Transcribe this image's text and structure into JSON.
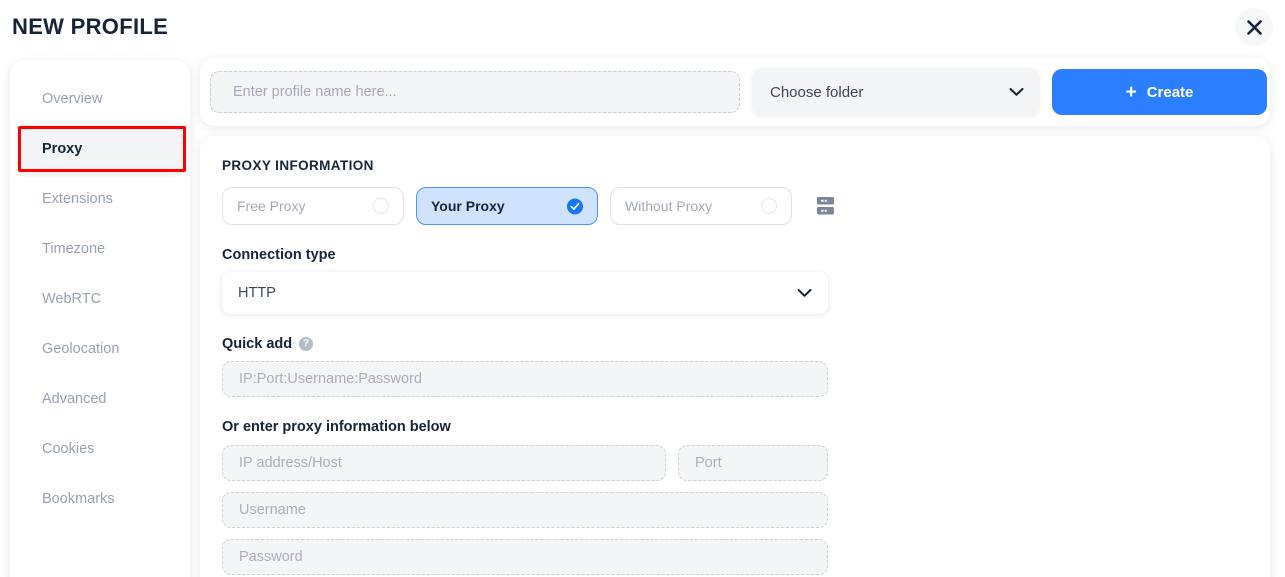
{
  "header": {
    "title": "NEW PROFILE",
    "close_icon": "close-icon"
  },
  "sidebar": {
    "items": [
      {
        "label": "Overview",
        "active": false
      },
      {
        "label": "Proxy",
        "active": true
      },
      {
        "label": "Extensions",
        "active": false
      },
      {
        "label": "Timezone",
        "active": false
      },
      {
        "label": "WebRTC",
        "active": false
      },
      {
        "label": "Geolocation",
        "active": false
      },
      {
        "label": "Advanced",
        "active": false
      },
      {
        "label": "Cookies",
        "active": false
      },
      {
        "label": "Bookmarks",
        "active": false
      }
    ]
  },
  "toolbar": {
    "profile_name_value": "",
    "profile_name_placeholder": "Enter profile name here...",
    "folder_label": "Choose folder",
    "folder_chevron_icon": "chevron-down-icon",
    "create_label": "Create",
    "create_plus_icon": "plus-icon"
  },
  "proxy": {
    "section_title": "PROXY INFORMATION",
    "modes": [
      {
        "label": "Free Proxy",
        "selected": false
      },
      {
        "label": "Your Proxy",
        "selected": true
      },
      {
        "label": "Without Proxy",
        "selected": false
      }
    ],
    "server_icon": "server-icon",
    "connection_type_label": "Connection type",
    "connection_type_value": "HTTP",
    "connection_chevron_icon": "chevron-down-icon",
    "quick_add_label": "Quick add",
    "quick_add_help_icon": "help-icon",
    "quick_add_help_glyph": "?",
    "quick_add_value": "",
    "quick_add_placeholder": "IP:Port:Username:Password",
    "manual_entry_label": "Or enter proxy information below",
    "ip_value": "",
    "ip_placeholder": "IP address/Host",
    "port_value": "",
    "port_placeholder": "Port",
    "username_value": "",
    "username_placeholder": "Username",
    "password_value": "",
    "password_placeholder": "Password"
  },
  "colors": {
    "accent_blue": "#2b7fff",
    "selected_chip_bg": "#cfe3ff",
    "annotation_red": "#ff0000",
    "text_dark": "#16243a",
    "text_muted": "#98a2b3"
  }
}
